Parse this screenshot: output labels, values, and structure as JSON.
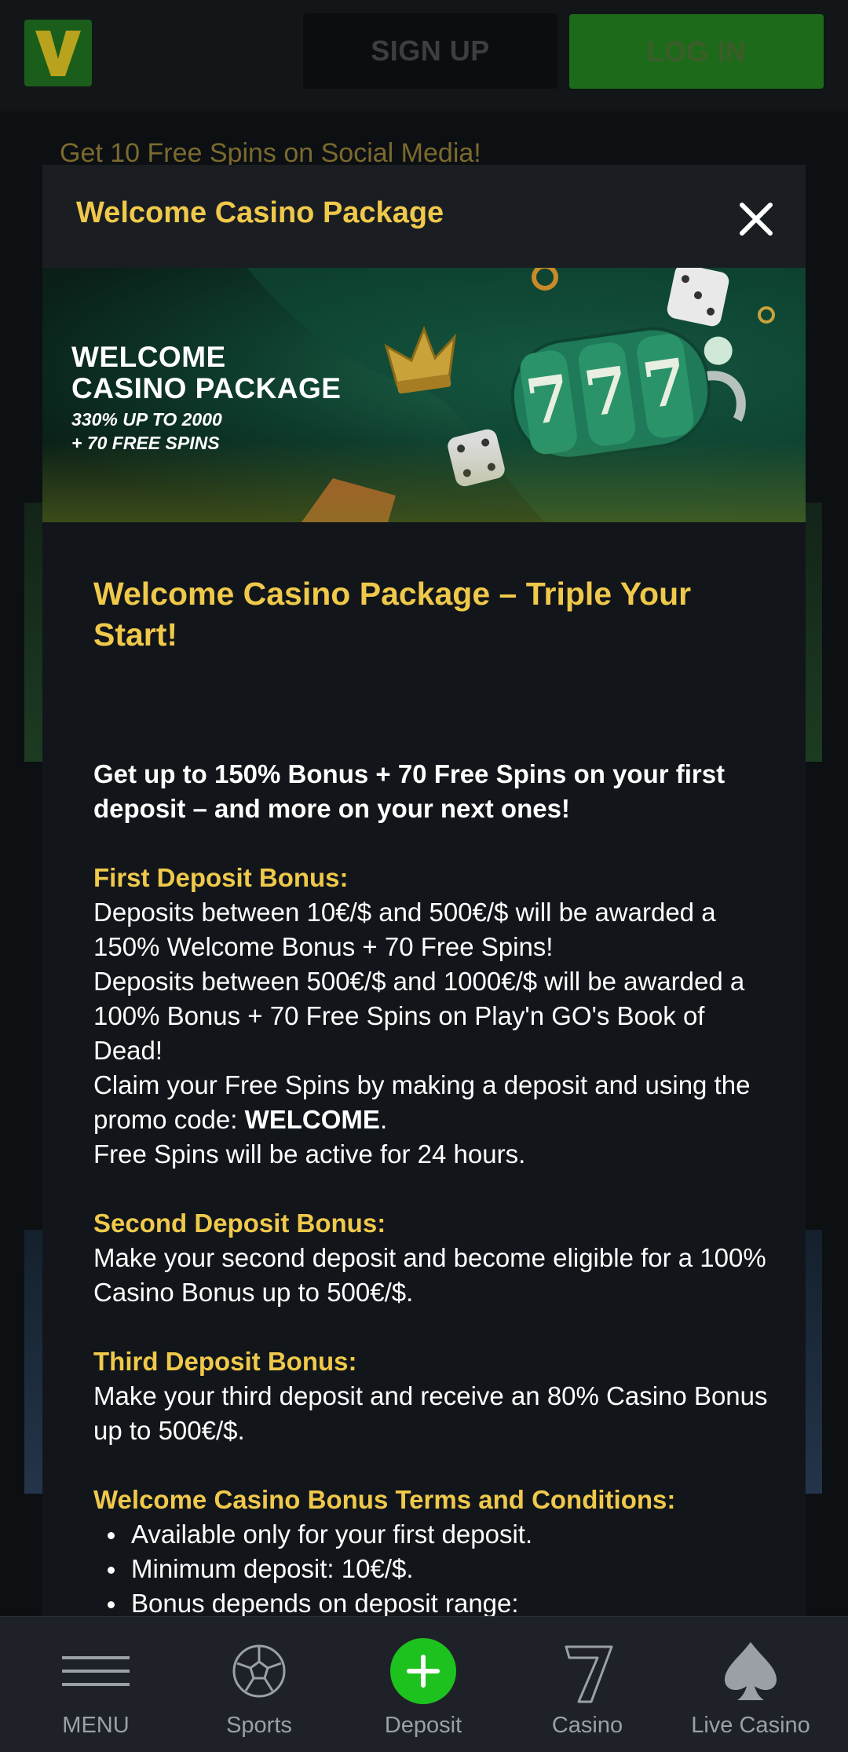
{
  "header": {
    "logo_letter": "V",
    "signup_label": "SIGN UP",
    "login_label": "LOG IN"
  },
  "background": {
    "promo_text": "Get 10 Free Spins on Social Media!"
  },
  "modal": {
    "title": "Welcome Casino Package",
    "close_icon": "close-icon",
    "hero": {
      "line1": "WELCOME",
      "line2": "CASINO PACKAGE",
      "line3": "330% UP TO 2000",
      "line4": "+ 70 FREE SPINS",
      "slot_digits": "777"
    },
    "heading": "Welcome Casino Package – Triple Your Start!",
    "intro": "Get up to 150% Bonus + 70 Free Spins on your first deposit – and more on your next ones!",
    "first": {
      "title": "First Deposit Bonus:",
      "text1": "Deposits between 10€/$ and 500€/$ will be awarded a 150% Welcome Bonus + 70 Free Spins!",
      "text2": "Deposits between 500€/$ and 1000€/$ will be awarded a 100% Bonus + 70 Free Spins on Play'n GO's Book of Dead!",
      "text3_pre": "Claim your Free Spins by making a deposit and using the promo code: ",
      "promo_code": "WELCOME",
      "text3_post": ".",
      "text4": "Free Spins will be active for 24 hours."
    },
    "second": {
      "title": "Second Deposit Bonus:",
      "text": "Make your second deposit and become eligible for a 100% Casino Bonus up to 500€/$."
    },
    "third": {
      "title": "Third Deposit Bonus:",
      "text": "Make your third deposit and receive an 80% Casino Bonus up to 500€/$."
    },
    "terms": {
      "title": "Welcome Casino Bonus Terms and Conditions:",
      "items": [
        "Available only for your first deposit.",
        "Minimum deposit: 10€/$.",
        "Bonus depends on deposit range:"
      ]
    }
  },
  "bottom_nav": {
    "items": [
      {
        "label": "MENU",
        "icon": "hamburger-menu-icon"
      },
      {
        "label": "Sports",
        "icon": "soccer-ball-icon"
      },
      {
        "label": "Deposit",
        "icon": "plus-circle-icon"
      },
      {
        "label": "Casino",
        "icon": "seven-icon"
      },
      {
        "label": "Live Casino",
        "icon": "spade-icon"
      }
    ]
  },
  "colors": {
    "accent_gold": "#f0c94b",
    "deposit_green": "#1ec21e",
    "login_green": "#1d6b1a",
    "modal_bg": "#12161a"
  }
}
